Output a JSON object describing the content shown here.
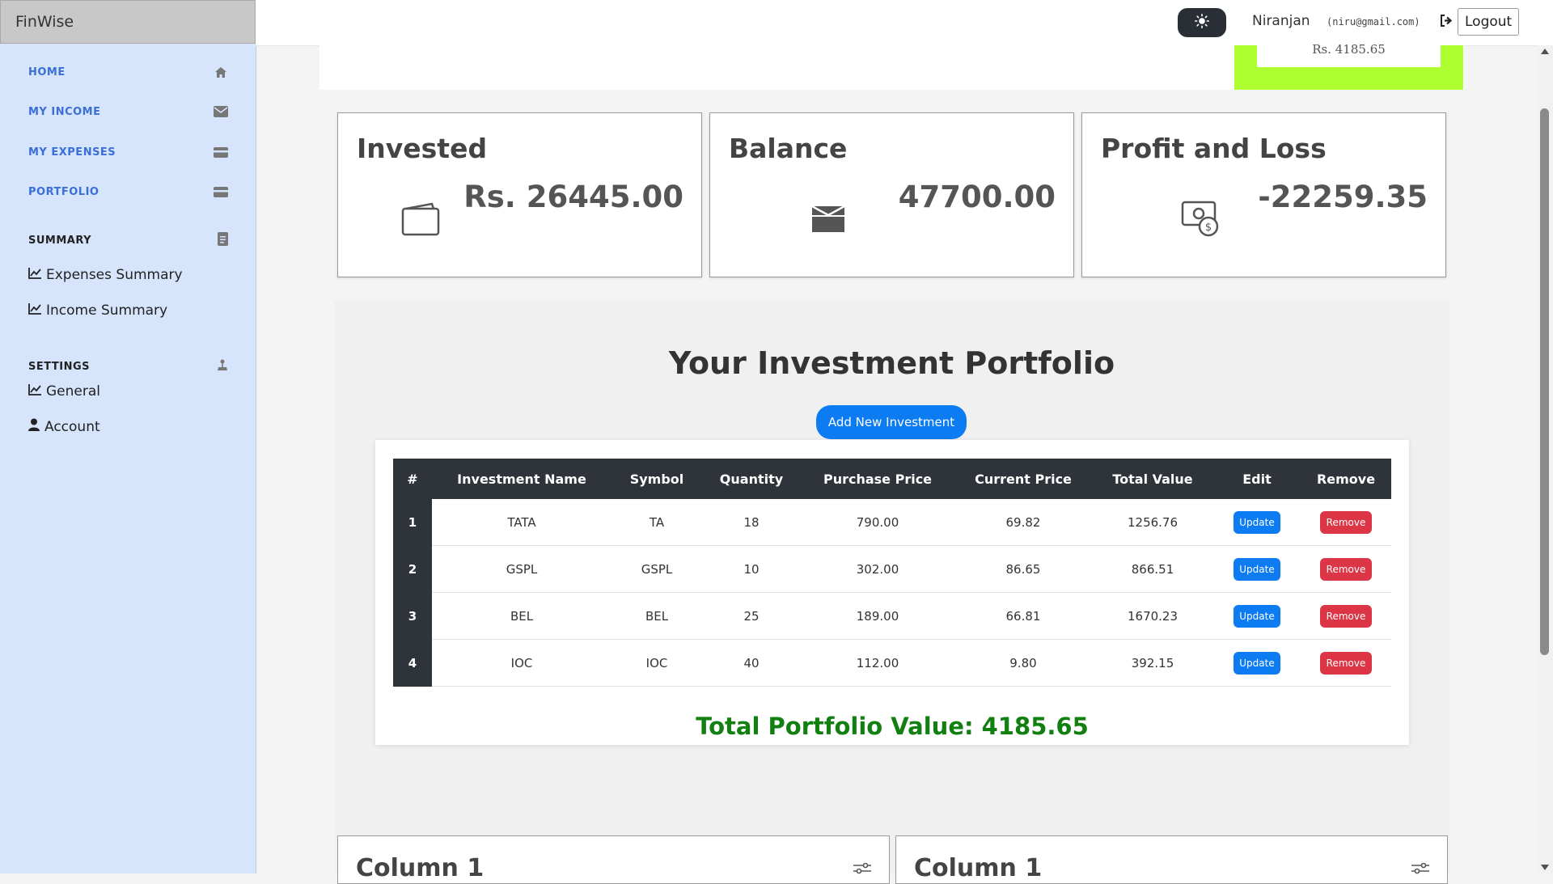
{
  "app": {
    "brand": "FinWise"
  },
  "sidebar": {
    "nav": [
      {
        "label": "HOME",
        "icon": "home-icon"
      },
      {
        "label": "MY INCOME",
        "icon": "envelope-icon"
      },
      {
        "label": "MY EXPENSES",
        "icon": "credit-card-icon"
      },
      {
        "label": "PORTFOLIO",
        "icon": "credit-card-icon"
      }
    ],
    "summary": {
      "heading": "SUMMARY",
      "links": [
        {
          "label": "Expenses Summary",
          "icon": "chart-line-icon"
        },
        {
          "label": "Income Summary",
          "icon": "chart-line-icon"
        }
      ]
    },
    "settings": {
      "heading": "SETTINGS",
      "links": [
        {
          "label": "General",
          "icon": "chart-line-icon"
        },
        {
          "label": "Account",
          "icon": "user-icon"
        }
      ]
    }
  },
  "topbar": {
    "user_name": "Niranjan",
    "user_email": "(niru@gmail.com)",
    "logout_label": "Logout"
  },
  "banner": {
    "portfolio_value": "Rs. 4185.65"
  },
  "stats": {
    "invested": {
      "title": "Invested",
      "value": "Rs. 26445.00"
    },
    "balance": {
      "title": "Balance",
      "value": "47700.00"
    },
    "pnl": {
      "title": "Profit and Loss",
      "value": "-22259.35"
    }
  },
  "portfolio": {
    "title": "Your Investment Portfolio",
    "add_label": "Add New Investment",
    "columns": [
      "#",
      "Investment Name",
      "Symbol",
      "Quantity",
      "Purchase Price",
      "Current Price",
      "Total Value",
      "Edit",
      "Remove"
    ],
    "rows": [
      {
        "idx": "1",
        "name": "TATA",
        "symbol": "TA",
        "qty": "18",
        "purchase": "790.00",
        "current": "69.82",
        "total": "1256.76"
      },
      {
        "idx": "2",
        "name": "GSPL",
        "symbol": "GSPL",
        "qty": "10",
        "purchase": "302.00",
        "current": "86.65",
        "total": "866.51"
      },
      {
        "idx": "3",
        "name": "BEL",
        "symbol": "BEL",
        "qty": "25",
        "purchase": "189.00",
        "current": "66.81",
        "total": "1670.23"
      },
      {
        "idx": "4",
        "name": "IOC",
        "symbol": "IOC",
        "qty": "40",
        "purchase": "112.00",
        "current": "9.80",
        "total": "392.15"
      }
    ],
    "update_label": "Update",
    "remove_label": "Remove",
    "total_text": "Total Portfolio Value: 4185.65"
  },
  "bottom_cards": [
    {
      "title": "Column 1"
    },
    {
      "title": "Column 1"
    }
  ],
  "colors": {
    "sidebar_bg": "#d6e4fc",
    "nav_text": "#3a6fd8",
    "primary": "#0d7cf2",
    "danger": "#dc3545",
    "success": "#118011",
    "highlight": "#adff2f",
    "table_header": "#2f333a"
  }
}
